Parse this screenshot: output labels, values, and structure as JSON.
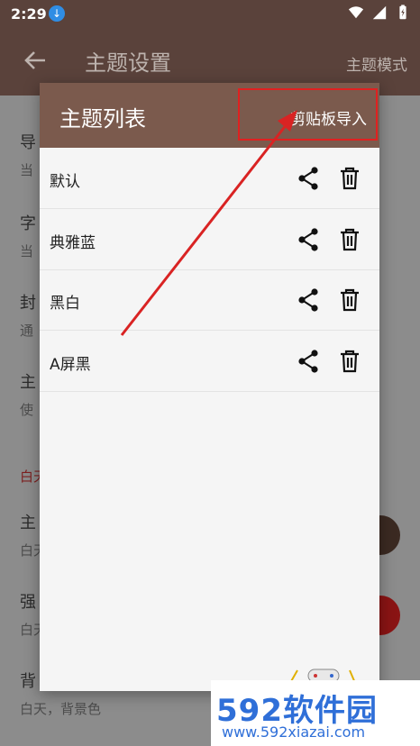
{
  "status_bar": {
    "time": "2:29"
  },
  "app_bar": {
    "title": "主题设置",
    "mode_button": "主题模式"
  },
  "background_list": {
    "rows": [
      {
        "title": "导",
        "subtitle": "当"
      },
      {
        "title": "字",
        "subtitle": "当"
      },
      {
        "title": "封",
        "subtitle": "通"
      },
      {
        "title": "主",
        "subtitle": "使"
      }
    ],
    "section_label": "白天",
    "color_rows": [
      {
        "title": "主",
        "subtitle": "白天"
      },
      {
        "title": "强",
        "subtitle": "白天"
      },
      {
        "title": "背",
        "subtitle": "白天，背景色"
      }
    ],
    "colors": {
      "primary": "#3b2a22",
      "accent": "#c11a1a"
    }
  },
  "dialog": {
    "title": "主题列表",
    "import_button": "剪贴板导入",
    "themes": [
      {
        "name": "默认"
      },
      {
        "name": "典雅蓝"
      },
      {
        "name": "黑白"
      },
      {
        "name": "A屏黑"
      }
    ]
  },
  "watermark": {
    "brand": "592软件园",
    "url": "www.592xiazai.com"
  },
  "colors": {
    "status_bar": "#5a423b",
    "dialog_header": "#7b5a4d",
    "highlight": "#e02020"
  }
}
